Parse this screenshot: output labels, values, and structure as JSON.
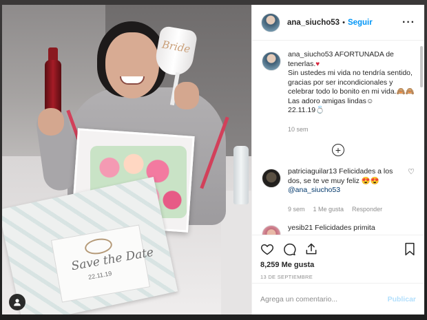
{
  "post": {
    "username": "ana_siucho53",
    "separator": "•",
    "follow_label": "Seguir",
    "more_label": "···"
  },
  "caption": {
    "username": "ana_siucho53",
    "line1": "AFORTUNADA de tenerlas.",
    "line2": "Sin ustedes mi vida no tendría sentido, gracias por ser incondicionales y celebrar todo lo bonito en mi vida.🙈🙈",
    "line3": "Las adoro amigas lindas☺",
    "line4": "22.11.19💍",
    "time": "10 sem"
  },
  "load_more_label": "+",
  "comments": [
    {
      "username": "patriciaguilar13",
      "text": "Felicidades a los dos, se te ve muy feliz 😍😍",
      "mention": "@ana_siucho53",
      "time": "9 sem",
      "likes": "1 Me gusta",
      "reply": "Responder",
      "like_icon": "♡"
    },
    {
      "username": "yesib21",
      "text": "Felicidades primita"
    }
  ],
  "actions": {
    "likes": "8,259 Me gusta",
    "date": "13 DE SEPTIEMBRE"
  },
  "composer": {
    "placeholder": "Agrega un comentario...",
    "publish_label": "Publicar"
  },
  "photo": {
    "glass_text": "Bride",
    "card_title": "Save the Date",
    "card_date": "22.11.19"
  },
  "colors": {
    "link_blue": "#0095f6",
    "publish_disabled": "#b2dffc",
    "muted_text": "#8e8e8e"
  }
}
